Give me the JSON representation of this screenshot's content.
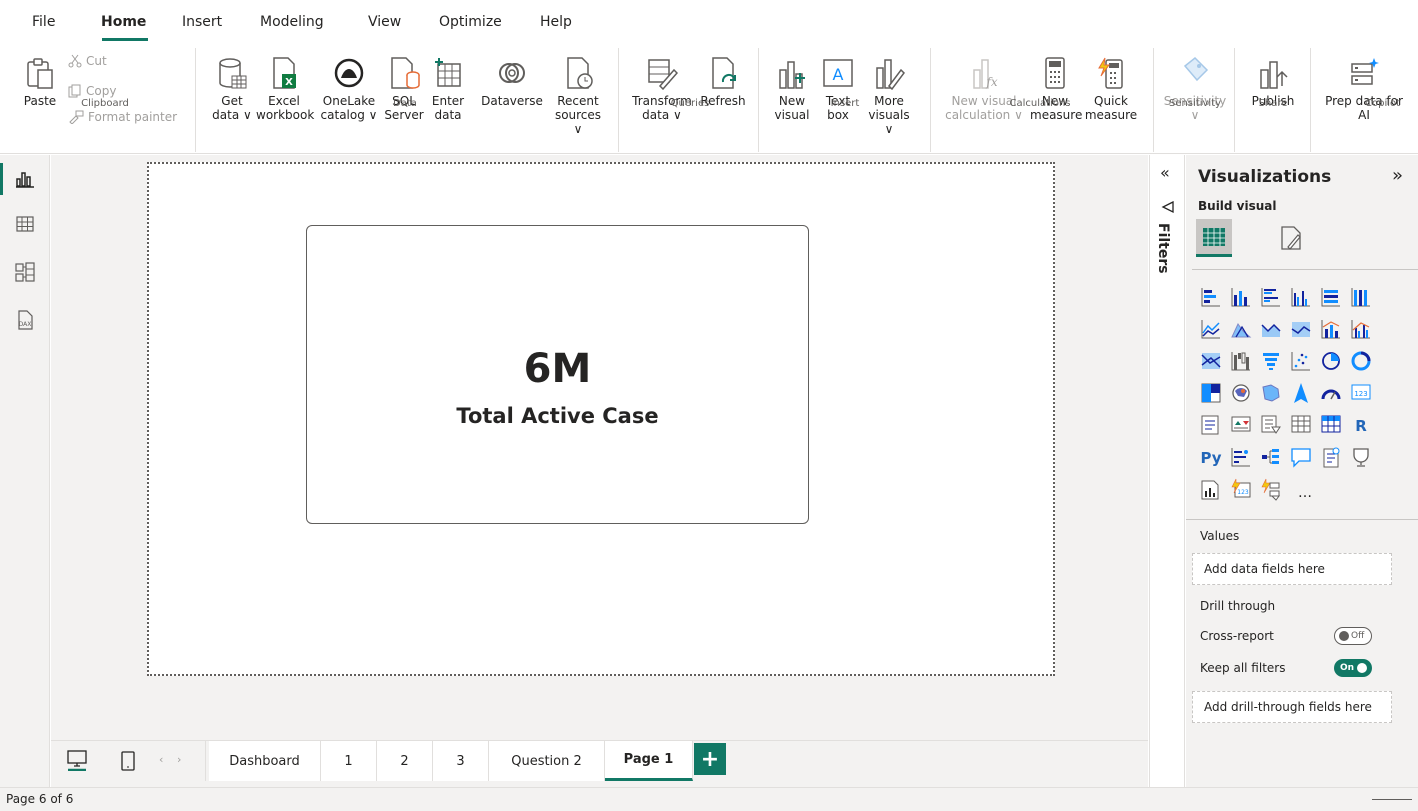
{
  "menu": {
    "items": [
      "File",
      "Home",
      "Insert",
      "Modeling",
      "View",
      "Optimize",
      "Help"
    ],
    "active": "Home"
  },
  "ribbon": {
    "clipboard": {
      "paste": "Paste",
      "cut": "Cut",
      "copy": "Copy",
      "format_painter": "Format painter",
      "group": "Clipboard"
    },
    "data": {
      "get_data": [
        "Get",
        "data ∨"
      ],
      "excel": [
        "Excel",
        "workbook"
      ],
      "onelake": [
        "OneLake",
        "catalog ∨"
      ],
      "sql": [
        "SQL",
        "Server"
      ],
      "enter": [
        "Enter",
        "data"
      ],
      "dataverse": "Dataverse",
      "recent": [
        "Recent",
        "sources ∨"
      ],
      "group": "Data"
    },
    "queries": {
      "transform": [
        "Transform",
        "data ∨"
      ],
      "refresh": "Refresh",
      "group": "Queries"
    },
    "insert": {
      "new_visual": [
        "New",
        "visual"
      ],
      "text_box": [
        "Text",
        "box"
      ],
      "more_visuals": [
        "More",
        "visuals ∨"
      ],
      "group": "Insert"
    },
    "calculations": {
      "new_visual_calc": [
        "New visual",
        "calculation ∨"
      ],
      "new_measure": [
        "New",
        "measure"
      ],
      "quick_measure": [
        "Quick",
        "measure"
      ],
      "group": "Calculations"
    },
    "sensitivity": {
      "label": [
        "Sensitivity",
        "∨"
      ],
      "group": "Sensitivity"
    },
    "share": {
      "publish": "Publish",
      "group": "Share"
    },
    "copilot": {
      "prep": [
        "Prep data for",
        "AI"
      ],
      "group": "Copilot"
    }
  },
  "card": {
    "value": "6M",
    "label": "Total Active Case"
  },
  "tabs": {
    "items": [
      "Dashboard",
      "1",
      "2",
      "3",
      "Question 2",
      "Page 1"
    ],
    "active": "Page 1",
    "add": "+"
  },
  "status": {
    "page_info": "Page 6 of 6"
  },
  "filters": {
    "label": "Filters"
  },
  "visualizations": {
    "title": "Visualizations",
    "build_visual": "Build visual",
    "values_label": "Values",
    "values_well": "Add data fields here",
    "drill_through": "Drill through",
    "cross_report": "Cross-report",
    "cross_report_state": "Off",
    "keep_filters": "Keep all filters",
    "keep_filters_state": "On",
    "drill_well": "Add drill-through fields here",
    "more": "…",
    "r_label": "R",
    "py_label": "Py",
    "number_label": "123"
  },
  "colors": {
    "accent": "#117865",
    "chart_blue": "#118dff",
    "dark_blue": "#12239e",
    "orange": "#e66c37",
    "gray": "#605e5c"
  }
}
